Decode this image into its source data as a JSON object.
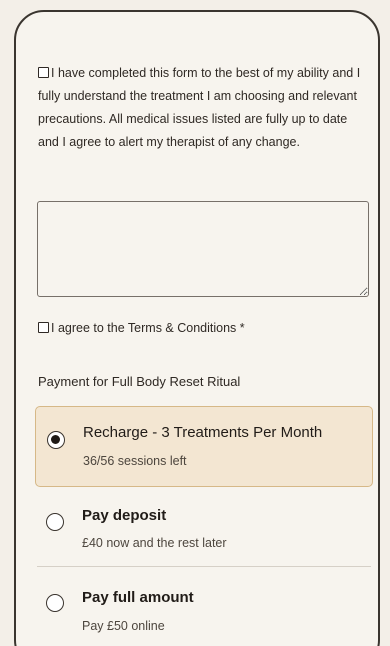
{
  "consent": {
    "text": "I have completed this form to the best of my ability and I fully understand the treatment I am choosing and relevant precautions. All medical issues listed are fully up to date and I agree to alert my therapist of any change.",
    "checked": false
  },
  "notes_field": {
    "value": ""
  },
  "terms": {
    "text": "I agree to the Terms & Conditions *",
    "checked": false
  },
  "payment": {
    "label": "Payment for Full Body Reset Ritual",
    "options": [
      {
        "title": "Recharge - 3 Treatments Per Month",
        "subtitle": "36/56 sessions left",
        "selected": true
      },
      {
        "title": "Pay deposit",
        "subtitle": "£40 now and the rest later",
        "selected": false
      },
      {
        "title": "Pay full amount",
        "subtitle": "Pay £50 online",
        "selected": false
      }
    ]
  },
  "colors": {
    "background": "#f3efe8",
    "card": "#f7f4ee",
    "selected_bg": "#f3e6d2",
    "selected_border": "#d6b887",
    "text": "#2c2620"
  },
  "icons": {
    "checkbox": "checkbox-icon",
    "radio_selected": "radio-selected-icon",
    "radio_unselected": "radio-unselected-icon"
  }
}
